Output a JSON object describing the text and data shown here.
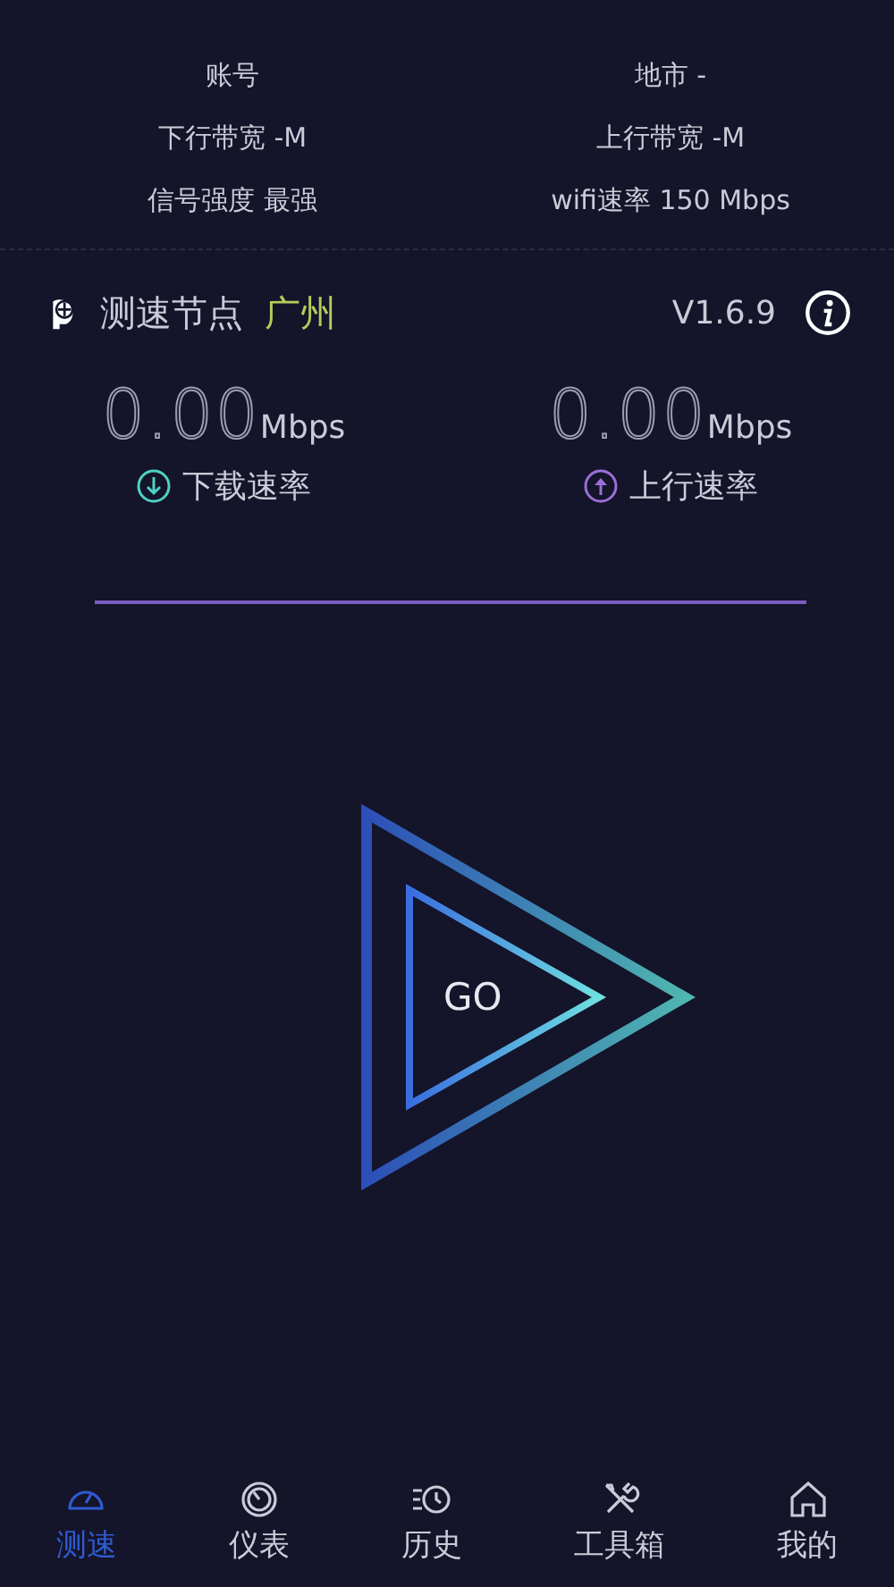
{
  "info": [
    {
      "text": "账号"
    },
    {
      "text": "地市 -"
    },
    {
      "text": "下行带宽 -M"
    },
    {
      "text": "上行带宽 -M"
    },
    {
      "text": "信号强度 最强"
    },
    {
      "text": "wifi速率 150 Mbps"
    }
  ],
  "node": {
    "label": "测速节点",
    "city": "广州",
    "version": "V1.6.9"
  },
  "speeds": [
    {
      "kind": "download",
      "value": "0.00",
      "unit": "Mbps",
      "label": "下载速率"
    },
    {
      "kind": "upload",
      "value": "0.00",
      "unit": "Mbps",
      "label": "上行速率"
    }
  ],
  "go_button": {
    "label": "GO"
  },
  "nav": [
    {
      "kind": "speed",
      "label": "测速",
      "selected": true
    },
    {
      "kind": "gauge",
      "label": "仪表",
      "selected": false
    },
    {
      "kind": "history",
      "label": "历史",
      "selected": false
    },
    {
      "kind": "tools",
      "label": "工具箱",
      "selected": false
    },
    {
      "kind": "home",
      "label": "我的",
      "selected": false
    }
  ]
}
